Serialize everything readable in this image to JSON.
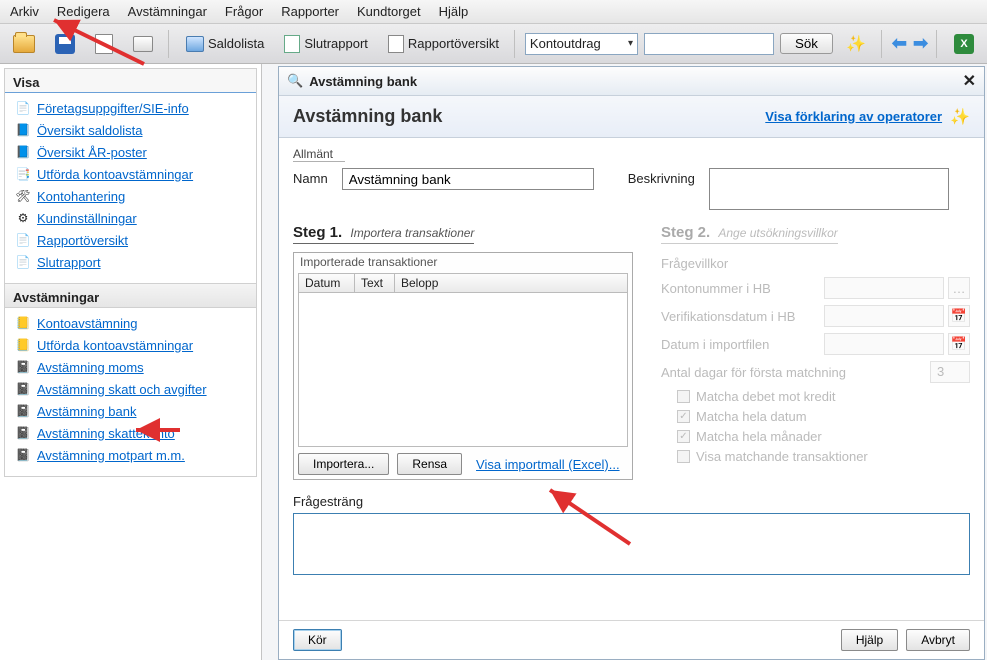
{
  "menu": [
    "Arkiv",
    "Redigera",
    "Avstämningar",
    "Frågor",
    "Rapporter",
    "Kundtorget",
    "Hjälp"
  ],
  "toolbar": {
    "saldolista": "Saldolista",
    "slutrapport": "Slutrapport",
    "rapportoversikt": "Rapportöversikt",
    "combo_value": "Kontoutdrag",
    "sok": "Sök"
  },
  "left": {
    "visa_header": "Visa",
    "visa_items": [
      "Företagsuppgifter/SIE-info",
      "Översikt saldolista",
      "Översikt ÅR-poster",
      "Utförda kontoavstämningar",
      "Kontohantering",
      "Kundinställningar",
      "Rapportöversikt",
      "Slutrapport"
    ],
    "avst_header": "Avstämningar",
    "avst_items": [
      "Kontoavstämning",
      "Utförda kontoavstämningar",
      "Avstämning moms",
      "Avstämning skatt och avgifter",
      "Avstämning bank",
      "Avstämning skattekonto",
      "Avstämning motpart m.m."
    ]
  },
  "dlg": {
    "window_title": "Avstämning bank",
    "heading": "Avstämning bank",
    "link": "Visa förklaring av operatorer",
    "allmant": "Allmänt",
    "namn_label": "Namn",
    "namn_value": "Avstämning bank",
    "beskr_label": "Beskrivning",
    "step1": "Steg 1.",
    "step1_sub": "Importera transaktioner",
    "step2": "Steg 2.",
    "step2_sub": "Ange utsökningsvillkor",
    "import_panel": "Importerade transaktioner",
    "grid_cols": [
      "Datum",
      "Text",
      "Belopp"
    ],
    "btn_import": "Importera...",
    "btn_rensa": "Rensa",
    "link_excel": "Visa importmall (Excel)...",
    "fragevillkor": "Frågevillkor",
    "f1": "Kontonummer i HB",
    "f2": "Verifikationsdatum i HB",
    "f3": "Datum i importfilen",
    "f4": "Antal dagar för första matchning",
    "f4_val": "3",
    "c1": "Matcha debet mot kredit",
    "c2": "Matcha hela datum",
    "c3": "Matcha hela månader",
    "c4": "Visa matchande transaktioner",
    "fragestrang": "Frågesträng",
    "kor": "Kör",
    "hjalp": "Hjälp",
    "avbryt": "Avbryt"
  }
}
